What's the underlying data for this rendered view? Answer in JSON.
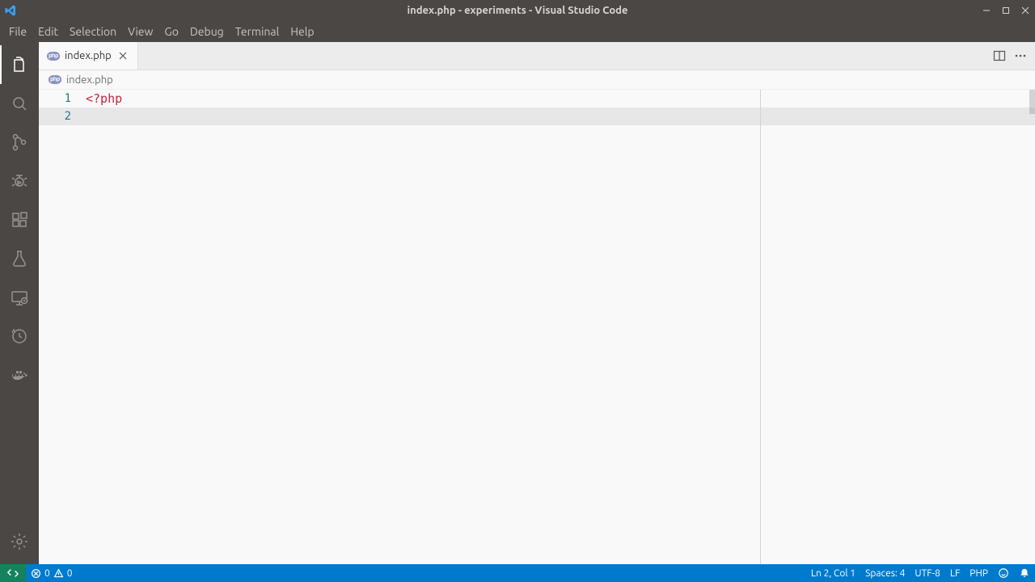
{
  "titlebar": {
    "title": "index.php - experiments - Visual Studio Code"
  },
  "menubar": [
    "File",
    "Edit",
    "Selection",
    "View",
    "Go",
    "Debug",
    "Terminal",
    "Help"
  ],
  "tab": {
    "label": "index.php"
  },
  "breadcrumb": {
    "file": "index.php"
  },
  "editor": {
    "lines": [
      {
        "num": "1",
        "text": "<?php",
        "cls": "tok-phpopen"
      },
      {
        "num": "2",
        "text": "",
        "cls": "",
        "current": true
      }
    ]
  },
  "statusbar": {
    "errors": "0",
    "warnings": "0",
    "cursor": "Ln 2, Col 1",
    "spaces": "Spaces: 4",
    "encoding": "UTF-8",
    "eol": "LF",
    "lang": "PHP"
  }
}
